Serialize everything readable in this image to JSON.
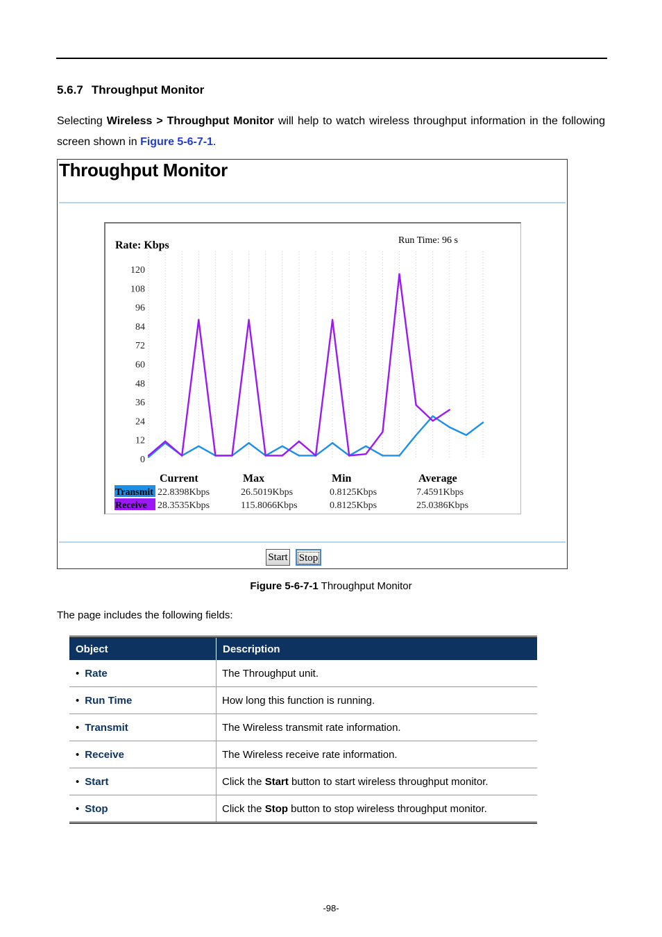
{
  "section": {
    "number": "5.6.7",
    "title": "Throughput Monitor"
  },
  "intro": {
    "p1": "Selecting",
    "menu_a": "Wireless",
    "sep": ">",
    "menu_b": "Throughput Monitor",
    "p2": "will help to watch wireless throughput information in the following screen shown in",
    "figure_ref": "Figure 5-6-7-1",
    "p3": "."
  },
  "screenshot": {
    "title": "Throughput Monitor",
    "rate_label": "Rate: Kbps",
    "run_time": "Run Time: 96 s",
    "stats": {
      "headers": [
        "Current",
        "Max",
        "Min",
        "Average"
      ],
      "rows": [
        {
          "label": "Transmit",
          "color": "#1e8fe6",
          "values": [
            "22.8398Kbps",
            "26.5019Kbps",
            "0.8125Kbps",
            "7.4591Kbps"
          ]
        },
        {
          "label": "Receive",
          "color": "#9b19f5",
          "values": [
            "28.3535Kbps",
            "115.8066Kbps",
            "0.8125Kbps",
            "25.0386Kbps"
          ]
        }
      ]
    },
    "start_label": "Start",
    "stop_label": "Stop"
  },
  "chart_data": {
    "type": "line",
    "yticks": [
      "120",
      "108",
      "96",
      "84",
      "72",
      "60",
      "48",
      "36",
      "24",
      "12",
      "0"
    ],
    "ylim": [
      0,
      120
    ],
    "x": [
      0,
      1,
      2,
      3,
      4,
      5,
      6,
      7,
      8,
      9,
      10,
      11,
      12,
      13,
      14,
      15,
      16,
      17,
      18,
      19,
      20
    ],
    "series": [
      {
        "name": "Transmit",
        "color": "#1e8fe6",
        "values": [
          1,
          10,
          2,
          8,
          2,
          2,
          10,
          2,
          8,
          2,
          2,
          10,
          2,
          8,
          2,
          2,
          15,
          27,
          20,
          15,
          23
        ]
      },
      {
        "name": "Receive",
        "color": "#9b19f5",
        "values": [
          2,
          11,
          2,
          88,
          2,
          2,
          88,
          2,
          2,
          11,
          2,
          88,
          2,
          3,
          17,
          117,
          34,
          24,
          31,
          0,
          0
        ]
      }
    ]
  },
  "caption": {
    "label": "Figure 5-6-7-1",
    "text": "Throughput Monitor"
  },
  "fields_intro": "The page includes the following fields:",
  "table": {
    "headers": [
      "Object",
      "Description"
    ],
    "rows": [
      {
        "object": "Rate",
        "pre": "The Throughput unit.",
        "bold": "",
        "post": ""
      },
      {
        "object": "Run Time",
        "pre": "How long this function is running.",
        "bold": "",
        "post": ""
      },
      {
        "object": "Transmit",
        "pre": "The Wireless transmit rate information.",
        "bold": "",
        "post": ""
      },
      {
        "object": "Receive",
        "pre": "The Wireless receive rate information.",
        "bold": "",
        "post": ""
      },
      {
        "object": "Start",
        "pre": "Click the ",
        "bold": "Start",
        "post": " button to start wireless throughput monitor."
      },
      {
        "object": "Stop",
        "pre": "Click the ",
        "bold": "Stop",
        "post": " button to stop wireless throughput monitor."
      }
    ]
  },
  "page_number": "-98-"
}
